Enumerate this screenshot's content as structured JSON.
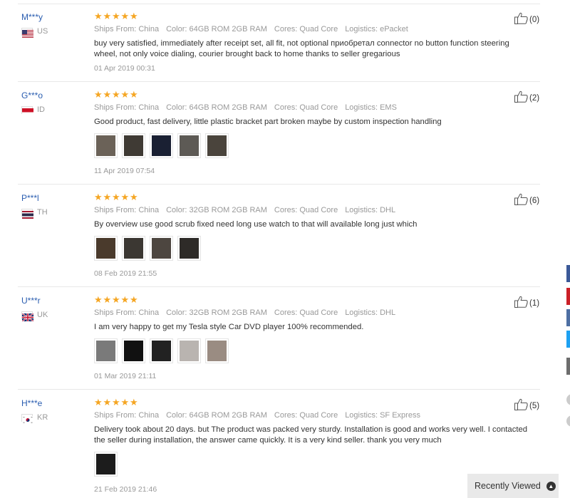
{
  "reviews": [
    {
      "user": "M***y",
      "country": "US",
      "flag": "us",
      "stars": 5,
      "meta": {
        "ships_from": "Ships From: China",
        "color": "Color: 64GB ROM 2GB RAM",
        "cores": "Cores: Quad Core",
        "logistics": "Logistics: ePacket"
      },
      "text": "buy very satisfied, immediately after receipt set, all fit, not optional приобретал connector no button function steering wheel, not only voice dialing, courier brought back to home thanks to seller gregarious",
      "photos": [],
      "date": "01 Apr 2019 00:31",
      "helpful": "(0)"
    },
    {
      "user": "G***o",
      "country": "ID",
      "flag": "id",
      "stars": 5,
      "meta": {
        "ships_from": "Ships From: China",
        "color": "Color: 64GB ROM 2GB RAM",
        "cores": "Cores: Quad Core",
        "logistics": "Logistics: EMS"
      },
      "text": "Good product, fast delivery, little plastic bracket part broken maybe by custom inspection handling",
      "photos": [
        "#6b6258",
        "#3f3a34",
        "#1a2033",
        "#5d5a55",
        "#4a443c"
      ],
      "date": "11 Apr 2019 07:54",
      "helpful": "(2)"
    },
    {
      "user": "P***l",
      "country": "TH",
      "flag": "th",
      "stars": 5,
      "meta": {
        "ships_from": "Ships From: China",
        "color": "Color: 32GB ROM 2GB RAM",
        "cores": "Cores: Quad Core",
        "logistics": "Logistics: DHL"
      },
      "text": "By overview use good scrub fixed need long use watch to that will available long just which",
      "photos": [
        "#4a3a2c",
        "#3b3732",
        "#4d4640",
        "#2e2b28"
      ],
      "date": "08 Feb 2019 21:55",
      "helpful": "(6)"
    },
    {
      "user": "U***r",
      "country": "UK",
      "flag": "uk",
      "stars": 5,
      "meta": {
        "ships_from": "Ships From: China",
        "color": "Color: 32GB ROM 2GB RAM",
        "cores": "Cores: Quad Core",
        "logistics": "Logistics: DHL"
      },
      "text": "I am very happy to get my Tesla style Car DVD player 100% recommended.",
      "photos": [
        "#7a7a7a",
        "#111111",
        "#222222",
        "#b9b4b0",
        "#9a8c82"
      ],
      "date": "01 Mar 2019 21:11",
      "helpful": "(1)"
    },
    {
      "user": "H***e",
      "country": "KR",
      "flag": "kr",
      "stars": 5,
      "meta": {
        "ships_from": "Ships From: China",
        "color": "Color: 64GB ROM 2GB RAM",
        "cores": "Cores: Quad Core",
        "logistics": "Logistics: SF Express"
      },
      "text": "Delivery took about 20 days. but The product was packed very sturdy. Installation is good and works very well. I contacted the seller during installation, the answer came quickly. It is a very kind seller. thank you very much",
      "photos": [
        "#1c1c1c"
      ],
      "date": "21 Feb 2019 21:46",
      "helpful": "(5)"
    }
  ],
  "share_colors": [
    "#3b5998",
    "#cb2027",
    "#4e6fa3",
    "#1da1f2",
    "#6d6d6d"
  ],
  "recently_viewed": {
    "label": "Recently Viewed",
    "icon": "chevron-up-icon"
  },
  "star_color": "#f5a623",
  "link_color": "#2a5db0"
}
